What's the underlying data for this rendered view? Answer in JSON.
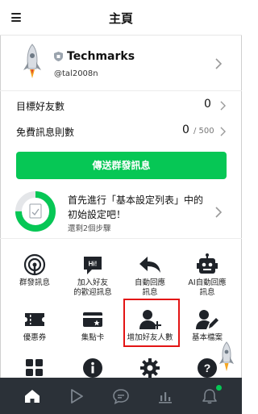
{
  "header": {
    "title": "主頁"
  },
  "account": {
    "name": "Techmarks",
    "id": "@tal2008n"
  },
  "stats": {
    "friends": {
      "label": "目標好友數",
      "value": "0"
    },
    "messages": {
      "label": "免費訊息則數",
      "value": "0",
      "limit": "/ 500"
    }
  },
  "broadcast_button": "傳送群發訊息",
  "setup": {
    "line1": "首先進行「基本設定列表」中的",
    "line2": "初始設定吧！",
    "remaining": "還剩2個步驟",
    "progress": 0.75
  },
  "grid": {
    "broadcast": "群發訊息",
    "welcome_1": "加入好友",
    "welcome_2": "的歡迎訊息",
    "auto_reply_1": "自動回應",
    "auto_reply_2": "訊息",
    "ai_reply_1": "AI自動回應",
    "ai_reply_2": "訊息",
    "coupon": "優惠券",
    "reward_card": "集點卡",
    "add_friends": "增加好友人數",
    "profile": "基本檔案"
  },
  "colors": {
    "accent": "#06c755",
    "nav_bg": "#2b3138",
    "highlight": "#e31414"
  }
}
